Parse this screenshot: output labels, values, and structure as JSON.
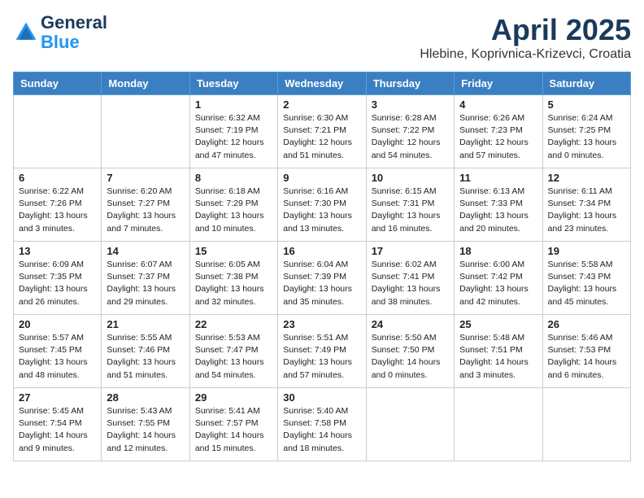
{
  "header": {
    "logo_line1": "General",
    "logo_line2": "Blue",
    "month_title": "April 2025",
    "location": "Hlebine, Koprivnica-Krizevci, Croatia"
  },
  "days_of_week": [
    "Sunday",
    "Monday",
    "Tuesday",
    "Wednesday",
    "Thursday",
    "Friday",
    "Saturday"
  ],
  "weeks": [
    [
      {
        "day": "",
        "info": ""
      },
      {
        "day": "",
        "info": ""
      },
      {
        "day": "1",
        "info": "Sunrise: 6:32 AM\nSunset: 7:19 PM\nDaylight: 12 hours\nand 47 minutes."
      },
      {
        "day": "2",
        "info": "Sunrise: 6:30 AM\nSunset: 7:21 PM\nDaylight: 12 hours\nand 51 minutes."
      },
      {
        "day": "3",
        "info": "Sunrise: 6:28 AM\nSunset: 7:22 PM\nDaylight: 12 hours\nand 54 minutes."
      },
      {
        "day": "4",
        "info": "Sunrise: 6:26 AM\nSunset: 7:23 PM\nDaylight: 12 hours\nand 57 minutes."
      },
      {
        "day": "5",
        "info": "Sunrise: 6:24 AM\nSunset: 7:25 PM\nDaylight: 13 hours\nand 0 minutes."
      }
    ],
    [
      {
        "day": "6",
        "info": "Sunrise: 6:22 AM\nSunset: 7:26 PM\nDaylight: 13 hours\nand 3 minutes."
      },
      {
        "day": "7",
        "info": "Sunrise: 6:20 AM\nSunset: 7:27 PM\nDaylight: 13 hours\nand 7 minutes."
      },
      {
        "day": "8",
        "info": "Sunrise: 6:18 AM\nSunset: 7:29 PM\nDaylight: 13 hours\nand 10 minutes."
      },
      {
        "day": "9",
        "info": "Sunrise: 6:16 AM\nSunset: 7:30 PM\nDaylight: 13 hours\nand 13 minutes."
      },
      {
        "day": "10",
        "info": "Sunrise: 6:15 AM\nSunset: 7:31 PM\nDaylight: 13 hours\nand 16 minutes."
      },
      {
        "day": "11",
        "info": "Sunrise: 6:13 AM\nSunset: 7:33 PM\nDaylight: 13 hours\nand 20 minutes."
      },
      {
        "day": "12",
        "info": "Sunrise: 6:11 AM\nSunset: 7:34 PM\nDaylight: 13 hours\nand 23 minutes."
      }
    ],
    [
      {
        "day": "13",
        "info": "Sunrise: 6:09 AM\nSunset: 7:35 PM\nDaylight: 13 hours\nand 26 minutes."
      },
      {
        "day": "14",
        "info": "Sunrise: 6:07 AM\nSunset: 7:37 PM\nDaylight: 13 hours\nand 29 minutes."
      },
      {
        "day": "15",
        "info": "Sunrise: 6:05 AM\nSunset: 7:38 PM\nDaylight: 13 hours\nand 32 minutes."
      },
      {
        "day": "16",
        "info": "Sunrise: 6:04 AM\nSunset: 7:39 PM\nDaylight: 13 hours\nand 35 minutes."
      },
      {
        "day": "17",
        "info": "Sunrise: 6:02 AM\nSunset: 7:41 PM\nDaylight: 13 hours\nand 38 minutes."
      },
      {
        "day": "18",
        "info": "Sunrise: 6:00 AM\nSunset: 7:42 PM\nDaylight: 13 hours\nand 42 minutes."
      },
      {
        "day": "19",
        "info": "Sunrise: 5:58 AM\nSunset: 7:43 PM\nDaylight: 13 hours\nand 45 minutes."
      }
    ],
    [
      {
        "day": "20",
        "info": "Sunrise: 5:57 AM\nSunset: 7:45 PM\nDaylight: 13 hours\nand 48 minutes."
      },
      {
        "day": "21",
        "info": "Sunrise: 5:55 AM\nSunset: 7:46 PM\nDaylight: 13 hours\nand 51 minutes."
      },
      {
        "day": "22",
        "info": "Sunrise: 5:53 AM\nSunset: 7:47 PM\nDaylight: 13 hours\nand 54 minutes."
      },
      {
        "day": "23",
        "info": "Sunrise: 5:51 AM\nSunset: 7:49 PM\nDaylight: 13 hours\nand 57 minutes."
      },
      {
        "day": "24",
        "info": "Sunrise: 5:50 AM\nSunset: 7:50 PM\nDaylight: 14 hours\nand 0 minutes."
      },
      {
        "day": "25",
        "info": "Sunrise: 5:48 AM\nSunset: 7:51 PM\nDaylight: 14 hours\nand 3 minutes."
      },
      {
        "day": "26",
        "info": "Sunrise: 5:46 AM\nSunset: 7:53 PM\nDaylight: 14 hours\nand 6 minutes."
      }
    ],
    [
      {
        "day": "27",
        "info": "Sunrise: 5:45 AM\nSunset: 7:54 PM\nDaylight: 14 hours\nand 9 minutes."
      },
      {
        "day": "28",
        "info": "Sunrise: 5:43 AM\nSunset: 7:55 PM\nDaylight: 14 hours\nand 12 minutes."
      },
      {
        "day": "29",
        "info": "Sunrise: 5:41 AM\nSunset: 7:57 PM\nDaylight: 14 hours\nand 15 minutes."
      },
      {
        "day": "30",
        "info": "Sunrise: 5:40 AM\nSunset: 7:58 PM\nDaylight: 14 hours\nand 18 minutes."
      },
      {
        "day": "",
        "info": ""
      },
      {
        "day": "",
        "info": ""
      },
      {
        "day": "",
        "info": ""
      }
    ]
  ]
}
